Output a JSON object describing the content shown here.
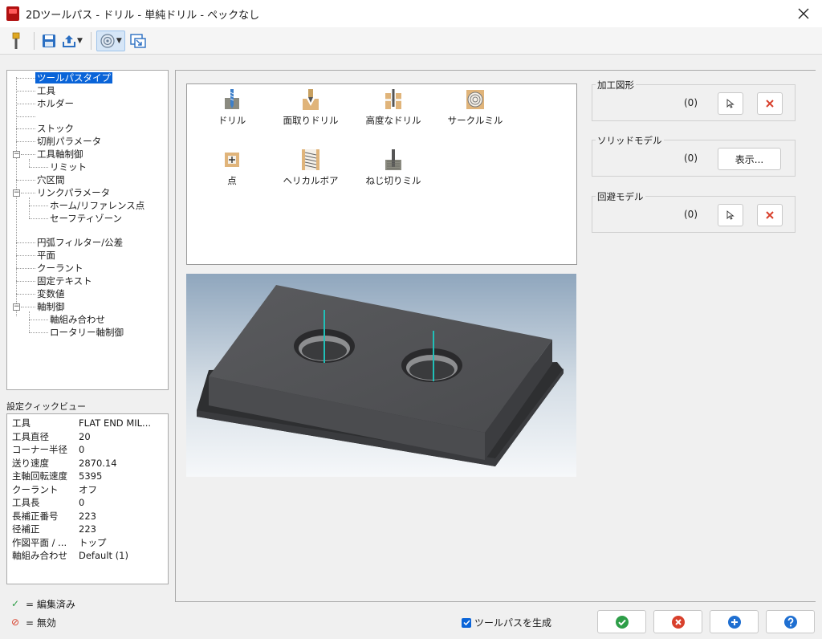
{
  "window": {
    "title": "2Dツールパス - ドリル - 単純ドリル - ペックなし"
  },
  "toolbar": {
    "items": [
      {
        "name": "tool-icon"
      },
      {
        "name": "save-icon"
      },
      {
        "name": "export-icon"
      },
      {
        "name": "view-options-icon"
      },
      {
        "name": "expand-dialog-icon"
      }
    ]
  },
  "tree": {
    "items": [
      {
        "label": "ツールパスタイプ",
        "selected": true
      },
      {
        "label": "工具"
      },
      {
        "label": "ホルダー"
      },
      {
        "label": "ストック"
      },
      {
        "label": "切削パラメータ"
      },
      {
        "label": "工具軸制御"
      },
      {
        "label": "リミット"
      },
      {
        "label": "穴区間"
      },
      {
        "label": "リンクパラメータ"
      },
      {
        "label": "ホーム/リファレンス点"
      },
      {
        "label": "セーフティゾーン"
      },
      {
        "label": "円弧フィルター/公差"
      },
      {
        "label": "平面"
      },
      {
        "label": "クーラント"
      },
      {
        "label": "固定テキスト"
      },
      {
        "label": "変数値"
      },
      {
        "label": "軸制御"
      },
      {
        "label": "軸組み合わせ"
      },
      {
        "label": "ロータリー軸制御"
      }
    ]
  },
  "quickview": {
    "title": "設定クィックビュー",
    "rows": [
      {
        "key": "工具",
        "value": "FLAT END MIL..."
      },
      {
        "key": "工具直径",
        "value": "20"
      },
      {
        "key": "コーナー半径",
        "value": "0"
      },
      {
        "key": "送り速度",
        "value": "2870.14"
      },
      {
        "key": "主軸回転速度",
        "value": "5395"
      },
      {
        "key": "クーラント",
        "value": "オフ"
      },
      {
        "key": "工具長",
        "value": "0"
      },
      {
        "key": "長補正番号",
        "value": "223"
      },
      {
        "key": "径補正",
        "value": "223"
      },
      {
        "key": "作図平面 / ...",
        "value": "トップ"
      },
      {
        "key": "軸組み合わせ",
        "value": "Default (1)"
      }
    ]
  },
  "legend": {
    "edited_symbol": "✓",
    "edited_label": "= 編集済み",
    "disabled_symbol": "⊘",
    "disabled_label": "= 無効"
  },
  "toolpath_types": {
    "items": [
      {
        "label": "ドリル",
        "icon": "drill-icon"
      },
      {
        "label": "面取りドリル",
        "icon": "chamfer-drill-icon"
      },
      {
        "label": "高度なドリル",
        "icon": "advanced-drill-icon"
      },
      {
        "label": "サークルミル",
        "icon": "circle-mill-icon"
      },
      {
        "label": "点",
        "icon": "point-icon"
      },
      {
        "label": "ヘリカルボア",
        "icon": "helix-bore-icon"
      },
      {
        "label": "ねじ切りミル",
        "icon": "thread-mill-icon"
      }
    ]
  },
  "groups": {
    "machining_geometry": {
      "title": "加工図形",
      "count": "(0)"
    },
    "solid_model": {
      "title": "ソリッドモデル",
      "count": "(0)",
      "show_label": "表示..."
    },
    "avoid_model": {
      "title": "回避モデル",
      "count": "(0)"
    }
  },
  "footer": {
    "generate_label": "ツールパスを生成",
    "generate_checked": true
  },
  "colors": {
    "selection": "#0a64d8",
    "ok_green": "#2e9e48",
    "cancel_red": "#d8402c",
    "apply_blue": "#1f6fd1",
    "help_blue": "#1f6fd1",
    "tool_axis_cyan": "#20c0b8",
    "stock_body": "#4a4b4e"
  }
}
